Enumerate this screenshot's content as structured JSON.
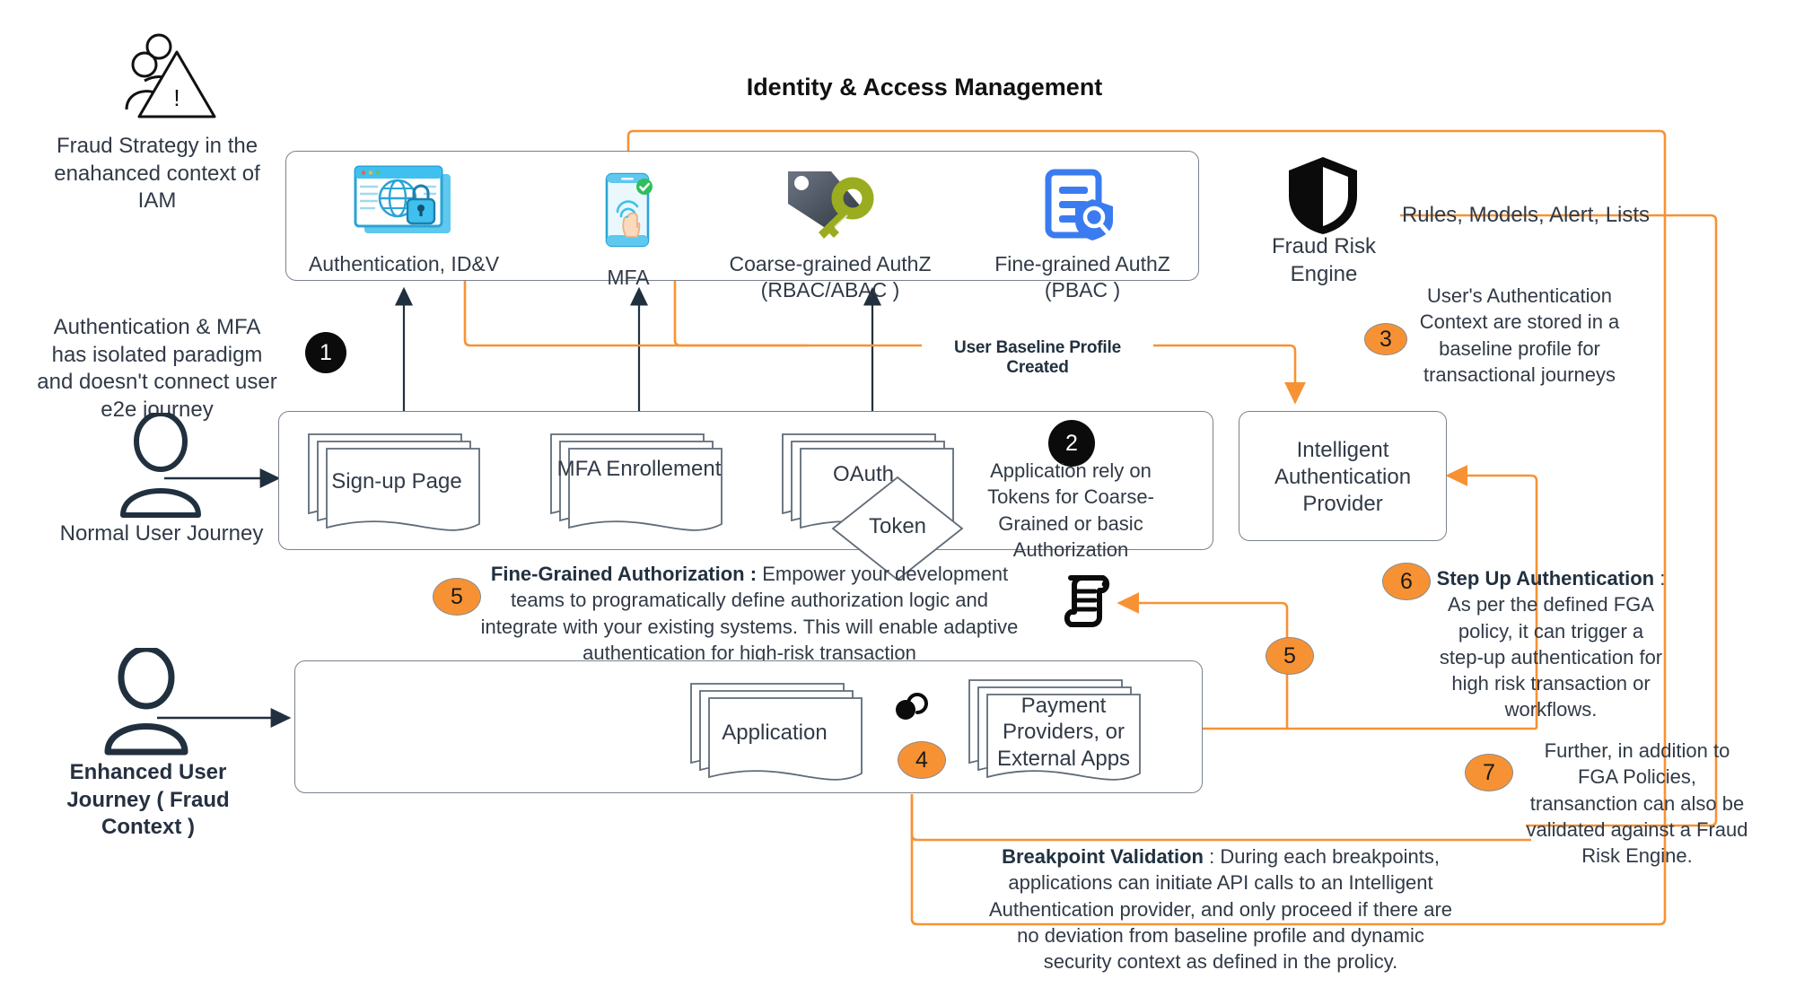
{
  "diagram": {
    "title": "Identity & Access Management",
    "left_captions": {
      "fraud_strategy": "Fraud Strategy in the enahanced context of IAM",
      "auth_mfa_isolated": "Authentication & MFA has isolated paradigm and doesn't connect user e2e journey",
      "normal_user": "Normal User Journey",
      "enhanced_user": "Enhanced User Journey ( Fraud Context )"
    },
    "iam_panel": {
      "tiles": [
        {
          "icon": "browser-globe-lock-icon",
          "label": "Authentication, ID&V"
        },
        {
          "icon": "mobile-fingerprint-check-icon",
          "label": "MFA"
        },
        {
          "icon": "tag-key-icon",
          "label": "Coarse-grained AuthZ\n(RBAC/ABAC )"
        },
        {
          "icon": "document-shield-search-icon",
          "label": "Fine-grained AuthZ\n(PBAC )"
        }
      ]
    },
    "fraud_risk_engine": {
      "icon": "shield-icon",
      "label": "Fraud Risk Engine",
      "feed_label": "Rules, Models, Alert, Lists"
    },
    "normal_journey": {
      "steps": [
        "Sign-up Page",
        "MFA Enrollement",
        "OAuth"
      ],
      "token_label": "Token"
    },
    "enhanced_journey": {
      "steps": [
        "Application",
        "Payment Providers, or External Apps"
      ],
      "policy_icon": "policy-scroll-icon"
    },
    "intelligent_auth_provider": {
      "label": "Intelligent Authentication Provider"
    },
    "edge_labels": {
      "user_baseline": "User Baseline Profile Created"
    },
    "numbered_notes": [
      {
        "n": "1",
        "style": "black",
        "text": ""
      },
      {
        "n": "2",
        "style": "black",
        "text": ""
      },
      {
        "n": "3",
        "style": "orange",
        "text": "User's Authentication Context are stored in a baseline profile for transactional journeys"
      },
      {
        "n": "4",
        "style": "orange",
        "text": ""
      },
      {
        "n": "5",
        "style": "orange",
        "bold_lead": "Fine-Grained Authorization :",
        "text": " Empower your development teams to programatically define authorization logic and integrate with your existing systems. This will enable adaptive authentication for high-risk transaction"
      },
      {
        "n": "5b",
        "style": "orange",
        "text": ""
      },
      {
        "n": "6",
        "style": "orange",
        "bold_lead": "Step Up Authentication",
        "text": " : As per the defined FGA policy, it can trigger a step-up authentication for high risk transaction or workflows."
      },
      {
        "n": "7",
        "style": "orange",
        "text": "Further, in addition to FGA Policies, transanction can also be validated against a Fraud Risk Engine."
      }
    ],
    "note_2_text": "Application rely on Tokens for Coarse-Grained or basic Authorization",
    "breakpoint_note": {
      "bold_lead": "Breakpoint Validation",
      "text": " : During each breakpoints, applications can initiate API calls to an Intelligent Authentication provider, and only proceed if there are no deviation from baseline profile and dynamic security context as defined in the prolicy."
    },
    "colors": {
      "accent_orange": "#F79234",
      "outline_gray": "#7a828c",
      "text_dark": "#313a46",
      "black": "#0b0b0b"
    }
  }
}
